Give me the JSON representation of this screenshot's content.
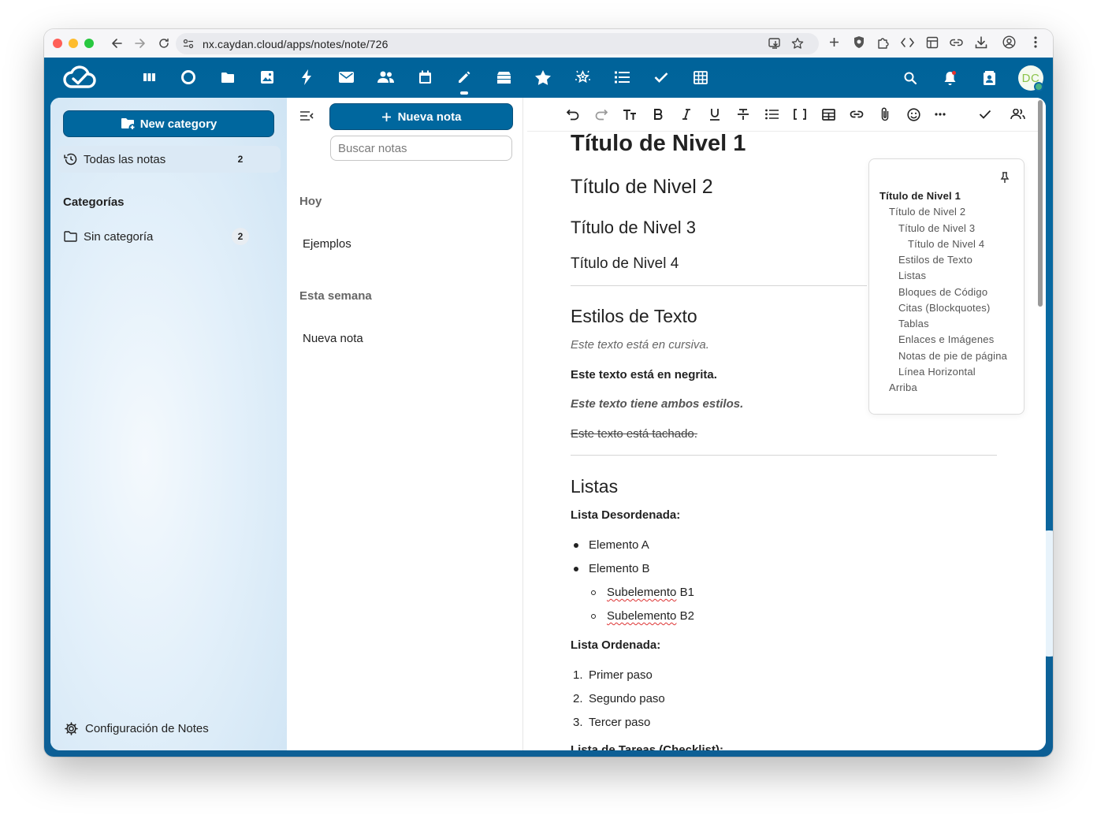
{
  "browser": {
    "url": "nx.caydan.cloud/apps/notes/note/726",
    "traffic_colors": [
      "#ff5f57",
      "#febc2e",
      "#28c840"
    ]
  },
  "topnav": {
    "apps": [
      "deck-icon",
      "talk-icon",
      "files-icon",
      "photos-icon",
      "activity-icon",
      "mail-icon",
      "contacts-icon",
      "calendar-icon",
      "notes-icon",
      "tables-files-icon",
      "starred-icon",
      "magic-icon",
      "tasks-list-icon",
      "checkmark-icon",
      "tables-icon"
    ],
    "active_app": "notes-icon",
    "avatar_initials": "DC",
    "brand_color": "#00679e"
  },
  "left_nav": {
    "new_category_label": "New category",
    "all_notes_label": "Todas las notas",
    "all_notes_count": "2",
    "categories_caption": "Categorías",
    "uncategorized_label": "Sin categoría",
    "uncategorized_count": "2",
    "settings_label": "Configuración de Notes"
  },
  "note_list": {
    "new_note_label": "Nueva nota",
    "search_placeholder": "Buscar notas",
    "groups": [
      {
        "title": "Hoy",
        "notes": [
          "Ejemplos"
        ]
      },
      {
        "title": "Esta semana",
        "notes": [
          "Nueva nota"
        ]
      }
    ]
  },
  "editor": {
    "toolbar": [
      "undo-icon",
      "redo-icon",
      "text-size-icon",
      "bold-icon",
      "italic-icon",
      "underline-icon",
      "strikethrough-icon",
      "bullet-list-icon",
      "code-brackets-icon",
      "table-icon",
      "link-icon",
      "attachment-icon",
      "emoji-icon",
      "more-icon",
      "done-icon",
      "share-users-icon"
    ],
    "h1": "Título de Nivel 1",
    "h2": "Título de Nivel 2",
    "h3": "Título de Nivel 3",
    "h4": "Título de Nivel 4",
    "styles_heading": "Estilos de Texto",
    "italic_text": "Este texto está en cursiva.",
    "bold_text": "Este texto está en negrita.",
    "both_text": "Este texto tiene ambos estilos.",
    "strike_text": "Este texto está tachado.",
    "lists_heading": "Listas",
    "unordered_caption": "Lista Desordenada:",
    "unordered": [
      "Elemento A",
      "Elemento B"
    ],
    "sub_items": [
      {
        "word": "Subelemento",
        "suffix": " B1"
      },
      {
        "word": "Subelemento",
        "suffix": " B2"
      }
    ],
    "ordered_caption": "Lista Ordenada:",
    "ordered": [
      {
        "n": "1.",
        "text": "Primer paso"
      },
      {
        "n": "2.",
        "text": "Segundo paso"
      },
      {
        "n": "3.",
        "text": "Tercer paso"
      }
    ],
    "checklist_caption": "Lista de Tareas (Checklist):"
  },
  "toc": {
    "items": [
      {
        "label": "Título de Nivel 1",
        "level": 1
      },
      {
        "label": "Título de Nivel 2",
        "level": 2
      },
      {
        "label": "Título de Nivel 3",
        "level": 3
      },
      {
        "label": "Título de Nivel 4",
        "level": 4
      },
      {
        "label": "Estilos de Texto",
        "level": 3
      },
      {
        "label": "Listas",
        "level": 3
      },
      {
        "label": "Bloques de Código",
        "level": 3
      },
      {
        "label": "Citas (Blockquotes)",
        "level": 3
      },
      {
        "label": "Tablas",
        "level": 3
      },
      {
        "label": "Enlaces e Imágenes",
        "level": 3
      },
      {
        "label": "Notas de pie de página",
        "level": 3
      },
      {
        "label": "Línea Horizontal",
        "level": 3
      },
      {
        "label": "Arriba",
        "level": 2
      }
    ]
  }
}
